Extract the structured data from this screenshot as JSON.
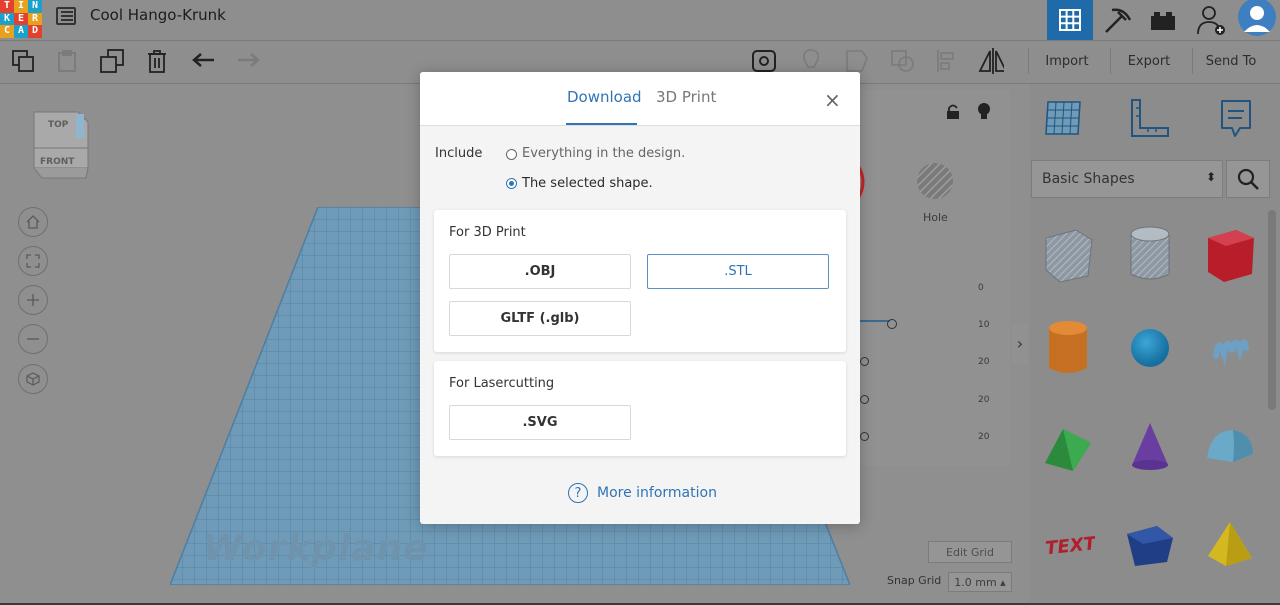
{
  "app": {
    "logo_letters": [
      "T",
      "I",
      "N",
      "K",
      "E",
      "R",
      "C",
      "A",
      "D"
    ],
    "logo_colors": [
      "#e2412f",
      "#e6a21e",
      "#1da0c9",
      "#1da0c9",
      "#e2412f",
      "#e6a21e",
      "#e6a21e",
      "#1da0c9",
      "#e2412f"
    ],
    "design_name": "Cool Hango-Krunk"
  },
  "toolbar": {
    "import_label": "Import",
    "export_label": "Export",
    "send_to_label": "Send To"
  },
  "viewcube": {
    "top_label": "TOP",
    "front_label": "FRONT"
  },
  "canvas": {
    "workplane_label": "Workplane",
    "edit_grid_label": "Edit Grid",
    "snap_grid_label": "Snap Grid",
    "snap_grid_value": "1.0 mm ▴"
  },
  "inspector": {
    "hole_label": "Hole",
    "ruler_values": [
      "0",
      "10",
      "20",
      "20",
      "20"
    ]
  },
  "shapes_panel": {
    "category": "Basic Shapes",
    "select_arrow": "⬍"
  },
  "modal": {
    "tab_download": "Download",
    "tab_3dprint": "3D Print",
    "close_glyph": "×",
    "include_label": "Include",
    "option_everything": "Everything in the design.",
    "option_selected": "The selected shape.",
    "section_3dprint_title": "For 3D Print",
    "btn_obj": ".OBJ",
    "btn_stl": ".STL",
    "btn_gltf": "GLTF (.glb)",
    "section_laser_title": "For Lasercutting",
    "btn_svg": ".SVG",
    "help_glyph": "?",
    "more_info": "More information"
  },
  "colors": {
    "accent": "#2f74b5",
    "grid_active": "#1f6aa8"
  }
}
